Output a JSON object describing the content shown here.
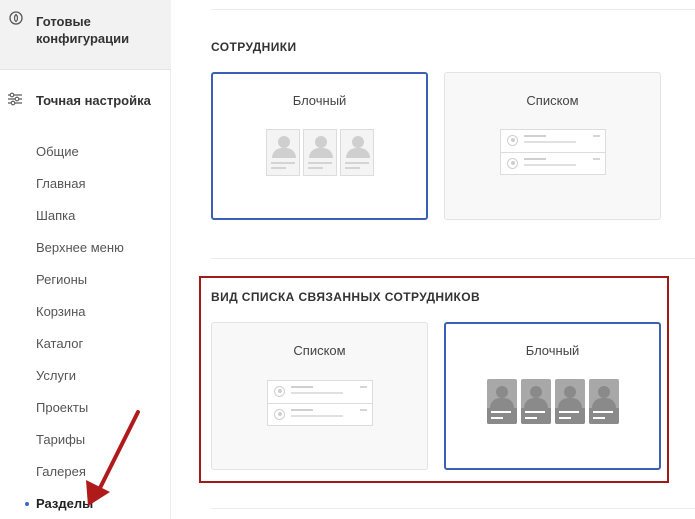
{
  "sidebar": {
    "ready_configs": {
      "title": "Готовые конфигурации",
      "icon": "config-circle-icon"
    },
    "fine_tuning": {
      "title": "Точная настройка",
      "icon": "sliders-icon",
      "items": [
        {
          "label": "Общие"
        },
        {
          "label": "Главная"
        },
        {
          "label": "Шапка"
        },
        {
          "label": "Верхнее меню"
        },
        {
          "label": "Регионы"
        },
        {
          "label": "Корзина"
        },
        {
          "label": "Каталог"
        },
        {
          "label": "Услуги"
        },
        {
          "label": "Проекты"
        },
        {
          "label": "Тарифы"
        },
        {
          "label": "Галерея"
        },
        {
          "label": "Разделы",
          "active": true
        }
      ]
    }
  },
  "sections": {
    "employees": {
      "title": "СОТРУДНИКИ",
      "options": [
        {
          "label": "Блочный",
          "selected": true
        },
        {
          "label": "Списком",
          "selected": false
        }
      ]
    },
    "related_employees": {
      "title": "ВИД СПИСКА СВЯЗАННЫХ СОТРУДНИКОВ",
      "options": [
        {
          "label": "Списком",
          "selected": false
        },
        {
          "label": "Блочный",
          "selected": true
        }
      ]
    }
  },
  "colors": {
    "selected_border": "#3c60b8",
    "highlight_border": "#a11a1a",
    "arrow": "#b01a1a",
    "active_dot": "#3a67c2"
  }
}
